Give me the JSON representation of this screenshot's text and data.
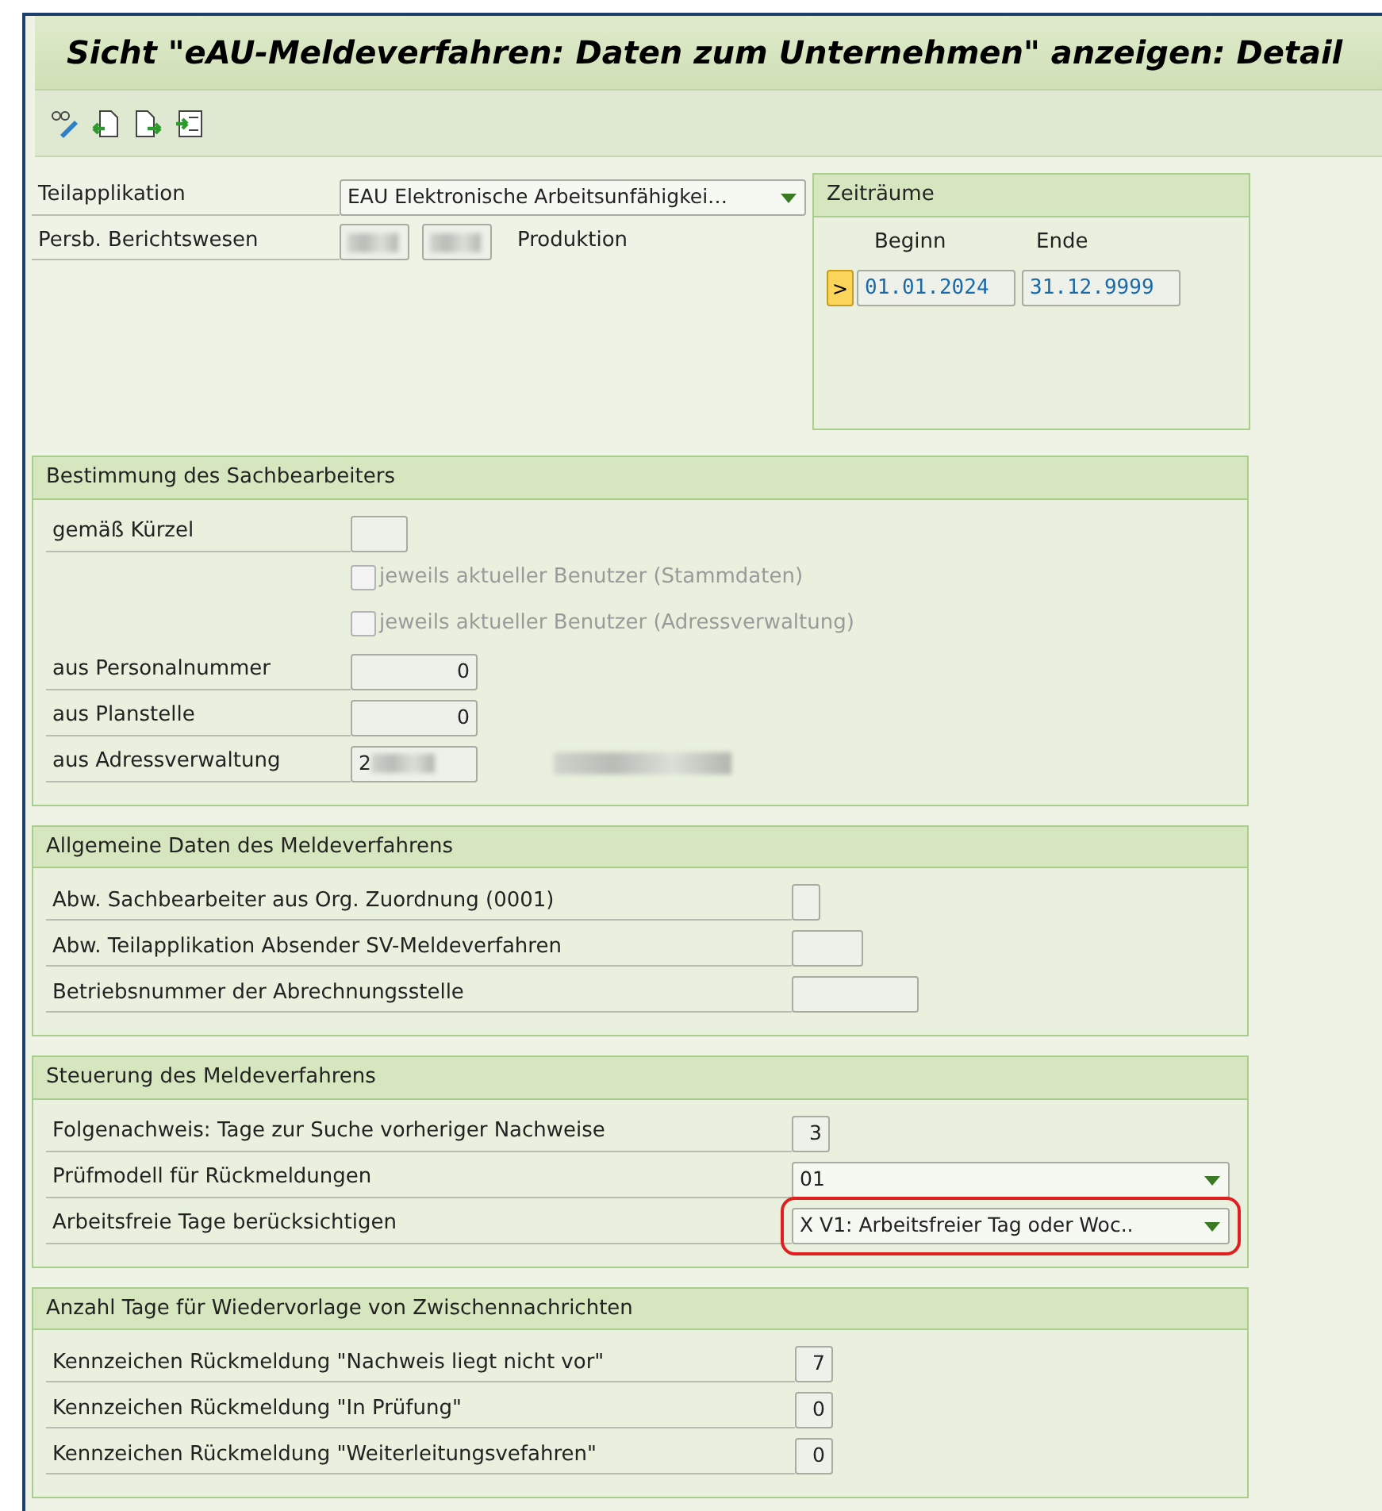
{
  "window": {
    "title": "Sicht \"eAU-Meldeverfahren: Daten zum Unternehmen\" anzeigen: Detail"
  },
  "header": {
    "teilapplikation": {
      "label": "Teilapplikation",
      "value": "EAU Elektronische Arbeitsunfähigkei…"
    },
    "berichtswesen": {
      "label": "Persb. Berichtswesen",
      "text": "Produktion"
    }
  },
  "zeitraeume": {
    "title": "Zeiträume",
    "columns": [
      "Beginn",
      "Ende"
    ],
    "marker": ">",
    "rows": [
      {
        "begin": "01.01.2024",
        "end": "31.12.9999"
      }
    ]
  },
  "sections": [
    {
      "title": "Bestimmung des Sachbearbeiters",
      "rows": [
        {
          "kind": "field",
          "label": "gemäß Kürzel",
          "value": ""
        },
        {
          "kind": "checkbox",
          "label": "jeweils aktueller Benutzer (Stammdaten)",
          "checked": false,
          "disabled": true
        },
        {
          "kind": "checkbox",
          "label": "jeweils aktueller Benutzer (Adressverwaltung)",
          "checked": false,
          "disabled": true
        },
        {
          "kind": "number",
          "label": "aus Personalnummer",
          "value": "0"
        },
        {
          "kind": "number",
          "label": "aus Planstelle",
          "value": "0"
        },
        {
          "kind": "blurred",
          "label": "aus Adressverwaltung",
          "value": "2"
        }
      ]
    },
    {
      "title": "Allgemeine Daten des Meldeverfahrens",
      "rows": [
        {
          "kind": "field",
          "label": "Abw. Sachbearbeiter aus Org. Zuordnung (0001)",
          "value": ""
        },
        {
          "kind": "field",
          "label": "Abw. Teilapplikation Absender SV-Meldeverfahren",
          "value": ""
        },
        {
          "kind": "field",
          "label": "Betriebsnummer der Abrechnungsstelle",
          "value": ""
        }
      ]
    },
    {
      "title": "Steuerung des Meldeverfahrens",
      "rows": [
        {
          "kind": "number",
          "label": "Folgenachweis: Tage zur Suche vorheriger Nachweise",
          "value": "3",
          "highlighted": false
        },
        {
          "kind": "dropdown",
          "label": "Prüfmodell für Rückmeldungen",
          "value": "01",
          "highlighted": false
        },
        {
          "kind": "dropdown",
          "label": "Arbeitsfreie Tage berücksichtigen",
          "value": "X V1: Arbeitsfreier Tag oder Woc..",
          "highlighted": true
        }
      ]
    },
    {
      "title": "Anzahl Tage für Wiedervorlage von Zwischennachrichten",
      "rows": [
        {
          "kind": "number",
          "label": "Kennzeichen Rückmeldung \"Nachweis liegt nicht vor\"",
          "value": "7"
        },
        {
          "kind": "number",
          "label": "Kennzeichen Rückmeldung \"In Prüfung\"",
          "value": "0"
        },
        {
          "kind": "number",
          "label": "Kennzeichen Rückmeldung \"Weiterleitungsvefahren\"",
          "value": "0"
        }
      ]
    }
  ]
}
